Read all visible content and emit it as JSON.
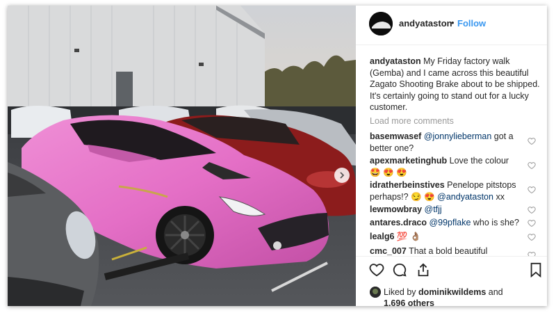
{
  "post": {
    "username": "andyataston",
    "follow_label": "Follow",
    "caption_user": "andyataston",
    "caption_text": "My Friday factory walk (Gemba) and I came across this beautiful Zagato Shooting Brake about to be shipped. It's certainly going to stand out for a lucky customer.",
    "load_more": "Load more comments",
    "comments": [
      {
        "user": "basemwasef",
        "mention": "@jonnylieberman",
        "text": " got a better one?"
      },
      {
        "user": "apexmarketinghub",
        "mention": "",
        "text": " Love the colour 🤩 😍 😍"
      },
      {
        "user": "idratherbeinstives",
        "mention": "@andyataston",
        "text": " Penelope pitstops perhaps!? 😏 😍 ",
        "trailing": " xx"
      },
      {
        "user": "lewmowbray",
        "mention": "@tfjj",
        "text": " "
      },
      {
        "user": "antares.draco",
        "mention": "@99pflake",
        "text": " who is she?"
      },
      {
        "user": "lealg6",
        "mention": "",
        "text": " 💯 👌🏽"
      },
      {
        "user": "cmc_007",
        "mention": "",
        "text": " That a bold beautiful statement right there!!"
      }
    ],
    "liked_by_prefix": "Liked by",
    "liked_by_user": "dominikwildems",
    "liked_by_and": "and",
    "likes_count": "1,696 others"
  },
  "icons": {
    "heart": "heart-icon",
    "comment": "comment-icon",
    "share": "share-icon",
    "bookmark": "bookmark-icon",
    "next": "chevron-right-icon"
  },
  "colors": {
    "accent": "#3897f0",
    "car_pink": "#e46fc6",
    "car_red": "#8c1c1c"
  }
}
